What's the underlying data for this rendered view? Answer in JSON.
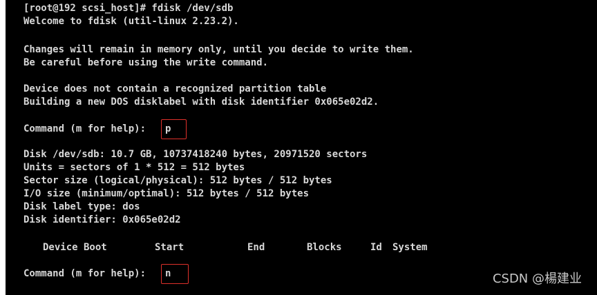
{
  "terminal": {
    "lines": [
      "[root@192 scsi_host]# fdisk /dev/sdb",
      "Welcome to fdisk (util-linux 2.23.2).",
      "",
      "Changes will remain in memory only, until you decide to write them.",
      "Be careful before using the write command.",
      "",
      "Device does not contain a recognized partition table",
      "Building a new DOS disklabel with disk identifier 0x065e02d2."
    ],
    "prompt1": {
      "label": "Command (m for help):",
      "input": "p"
    },
    "disk_info": [
      "Disk /dev/sdb: 10.7 GB, 10737418240 bytes, 20971520 sectors",
      "Units = sectors of 1 * 512 = 512 bytes",
      "Sector size (logical/physical): 512 bytes / 512 bytes",
      "I/O size (minimum/optimal): 512 bytes / 512 bytes",
      "Disk label type: dos",
      "Disk identifier: 0x065e02d2"
    ],
    "table_header": {
      "device_boot": "Device Boot",
      "start": "Start",
      "end": "End",
      "blocks": "Blocks",
      "id": "Id",
      "system": "System"
    },
    "prompt2": {
      "label": "Command (m for help):",
      "input": "n"
    }
  },
  "watermark": "CSDN @楊建业",
  "colors": {
    "background": "#000000",
    "text": "#d8d8d8",
    "highlight_border": "#e0312b",
    "watermark": "#c8c8c8"
  }
}
